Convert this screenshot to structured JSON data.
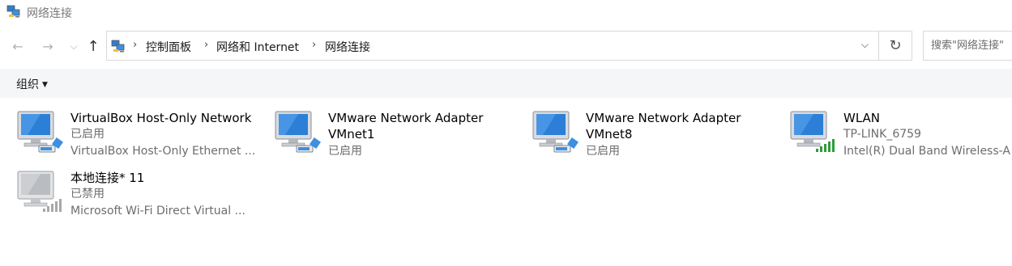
{
  "window": {
    "title": "网络连接",
    "app_icon": "network-folder-icon"
  },
  "nav": {
    "back_icon": "←",
    "forward_icon": "→",
    "recent_icon": "⌵",
    "up_icon": "↑",
    "breadcrumbs": [
      "控制面板",
      "网络和 Internet",
      "网络连接"
    ],
    "separator": "›",
    "dropdown_icon": "⌵",
    "refresh_icon": "↻",
    "search_placeholder": "搜索\"网络连接\""
  },
  "toolbar": {
    "organize_label": "组织",
    "organize_caret": "▼"
  },
  "connections": [
    {
      "name": "VirtualBox Host-Only Network",
      "status": "已启用",
      "device": "VirtualBox Host-Only Ethernet ...",
      "icon": "ethernet-adapter-icon",
      "state": "enabled"
    },
    {
      "name": "VMware Network Adapter",
      "name2": "VMnet1",
      "status": "已启用",
      "icon": "ethernet-adapter-icon",
      "state": "enabled"
    },
    {
      "name": "VMware Network Adapter",
      "name2": "VMnet8",
      "status": "已启用",
      "icon": "ethernet-adapter-icon",
      "state": "enabled"
    },
    {
      "name": "WLAN",
      "status": "TP-LINK_6759",
      "device": "Intel(R) Dual Band Wireless-A",
      "icon": "wireless-adapter-icon",
      "state": "connected"
    },
    {
      "name": "本地连接* 11",
      "status": "已禁用",
      "device": "Microsoft Wi-Fi Direct Virtual ...",
      "icon": "wireless-adapter-icon",
      "state": "disabled"
    }
  ],
  "colors": {
    "signal_active": "#2e9d3a",
    "signal_disabled": "#a8a8a8",
    "monitor_screen": "#2c7fd6",
    "toolbar_bg": "#f5f6f7"
  }
}
